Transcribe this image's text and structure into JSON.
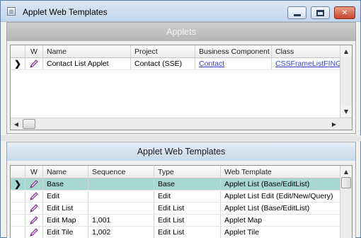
{
  "window": {
    "title": "Applet Web Templates",
    "controls": {
      "minimize": "minimize",
      "maximize": "maximize",
      "close": "✕"
    }
  },
  "applets": {
    "header": "Applets",
    "columns": [
      "",
      "W",
      "Name",
      "Project",
      "Business Component",
      "Class"
    ],
    "rows": [
      {
        "marker": "❯",
        "name": "Contact List Applet",
        "project": "Contact (SSE)",
        "business_component": "Contact",
        "class": "CSSFrameListFINGen"
      }
    ]
  },
  "templates": {
    "header": "Applet Web Templates",
    "columns": [
      "",
      "W",
      "Name",
      "Sequence",
      "Type",
      "Web Template"
    ],
    "rows": [
      {
        "marker": "❯",
        "name": "Base",
        "sequence": "",
        "type": "Base",
        "web_template": "Applet List (Base/EditList)",
        "selected": true
      },
      {
        "marker": "",
        "name": "Edit",
        "sequence": "",
        "type": "Edit",
        "web_template": "Applet List Edit (Edit/New/Query)",
        "selected": false
      },
      {
        "marker": "",
        "name": "Edit List",
        "sequence": "",
        "type": "Edit List",
        "web_template": "Applet List (Base/EditList)",
        "selected": false
      },
      {
        "marker": "",
        "name": "Edit Map",
        "sequence": "1,001",
        "type": "Edit List",
        "web_template": "Applet Map",
        "selected": false
      },
      {
        "marker": "",
        "name": "Edit Tile",
        "sequence": "1,002",
        "type": "Edit List",
        "web_template": "Applet Tile",
        "selected": false
      }
    ]
  },
  "colors": {
    "selected_row": "#a8d8d2",
    "link": "#3344cc"
  },
  "icons": {
    "edit": "pencil-icon",
    "current_row": "chevron-right-icon"
  }
}
